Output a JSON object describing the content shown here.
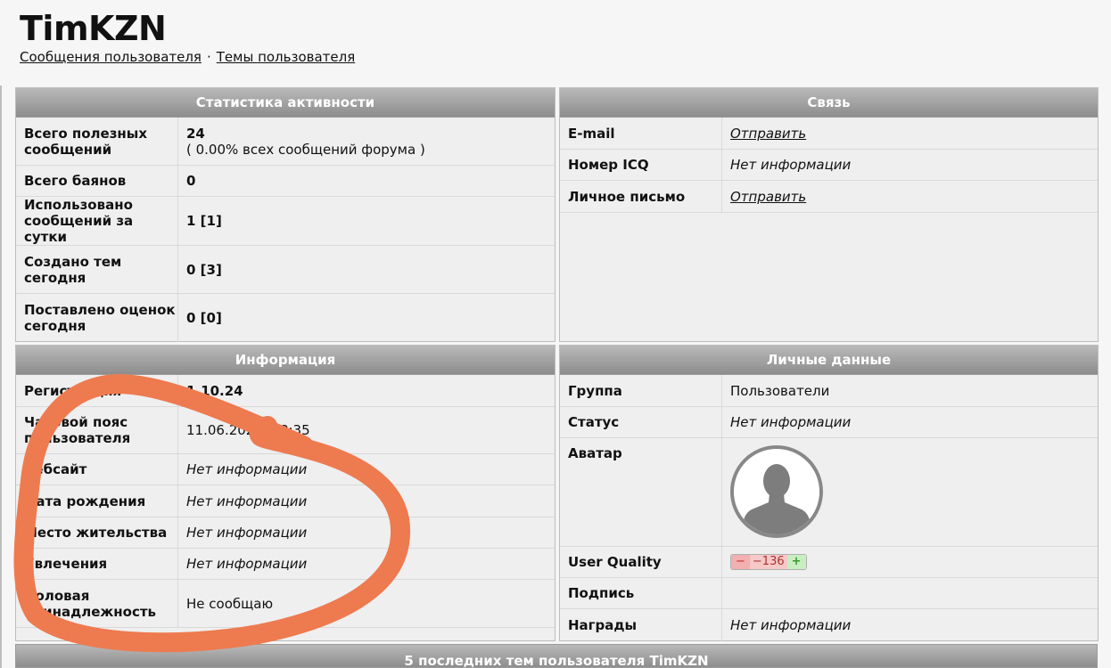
{
  "header": {
    "username": "TimKZN",
    "link_messages": "Сообщения пользователя",
    "separator": "·",
    "link_topics": "Темы пользователя"
  },
  "activity": {
    "title": "Статистика активности",
    "rows": [
      {
        "label": "Всего полезных сообщений",
        "value": "24",
        "sub": "( 0.00% всех сообщений форума )"
      },
      {
        "label": "Всего баянов",
        "value": "0"
      },
      {
        "label": "Использовано сообщений за сутки",
        "value": "1 [1]"
      },
      {
        "label": "Создано тем сегодня",
        "value": "0 [3]"
      },
      {
        "label": "Поставлено оценок сегодня",
        "value": "0 [0]"
      }
    ]
  },
  "contact": {
    "title": "Связь",
    "rows": [
      {
        "label": "E-mail",
        "value": "Отправить"
      },
      {
        "label": "Номер ICQ",
        "value": "Нет информации"
      },
      {
        "label": "Личное письмо",
        "value": "Отправить"
      }
    ]
  },
  "info": {
    "title": "Информация",
    "rows": [
      {
        "label": "Регистрация",
        "value": "1.10.24"
      },
      {
        "label": "Часовой пояс пользователя",
        "value": "11.06.2024, 08:35"
      },
      {
        "label": "Вебсайт",
        "value": "Нет информации"
      },
      {
        "label": "Дата рождения",
        "value": "Нет информации"
      },
      {
        "label": "Место жительства",
        "value": "Нет информации"
      },
      {
        "label": "Увлечения",
        "value": "Нет информации"
      },
      {
        "label": "Половая принадлежность",
        "value": "Не сообщаю"
      }
    ]
  },
  "personal": {
    "title": "Личные данные",
    "rows": [
      {
        "label": "Группа",
        "value": "Пользователи"
      },
      {
        "label": "Статус",
        "value": "Нет информации"
      },
      {
        "label": "Аватар"
      },
      {
        "label": "User Quality",
        "minus": "−",
        "score": "−136",
        "plus": "+"
      },
      {
        "label": "Подпись",
        "value": ""
      },
      {
        "label": "Награды",
        "value": "Нет информации"
      }
    ]
  },
  "recent": {
    "title": "5 последних тем пользователя TimKZN"
  },
  "colors": {
    "header_gradient_top": "#b9b9b9",
    "header_gradient_bottom": "#8d8d8d",
    "scribble": "#ee7a4f"
  }
}
